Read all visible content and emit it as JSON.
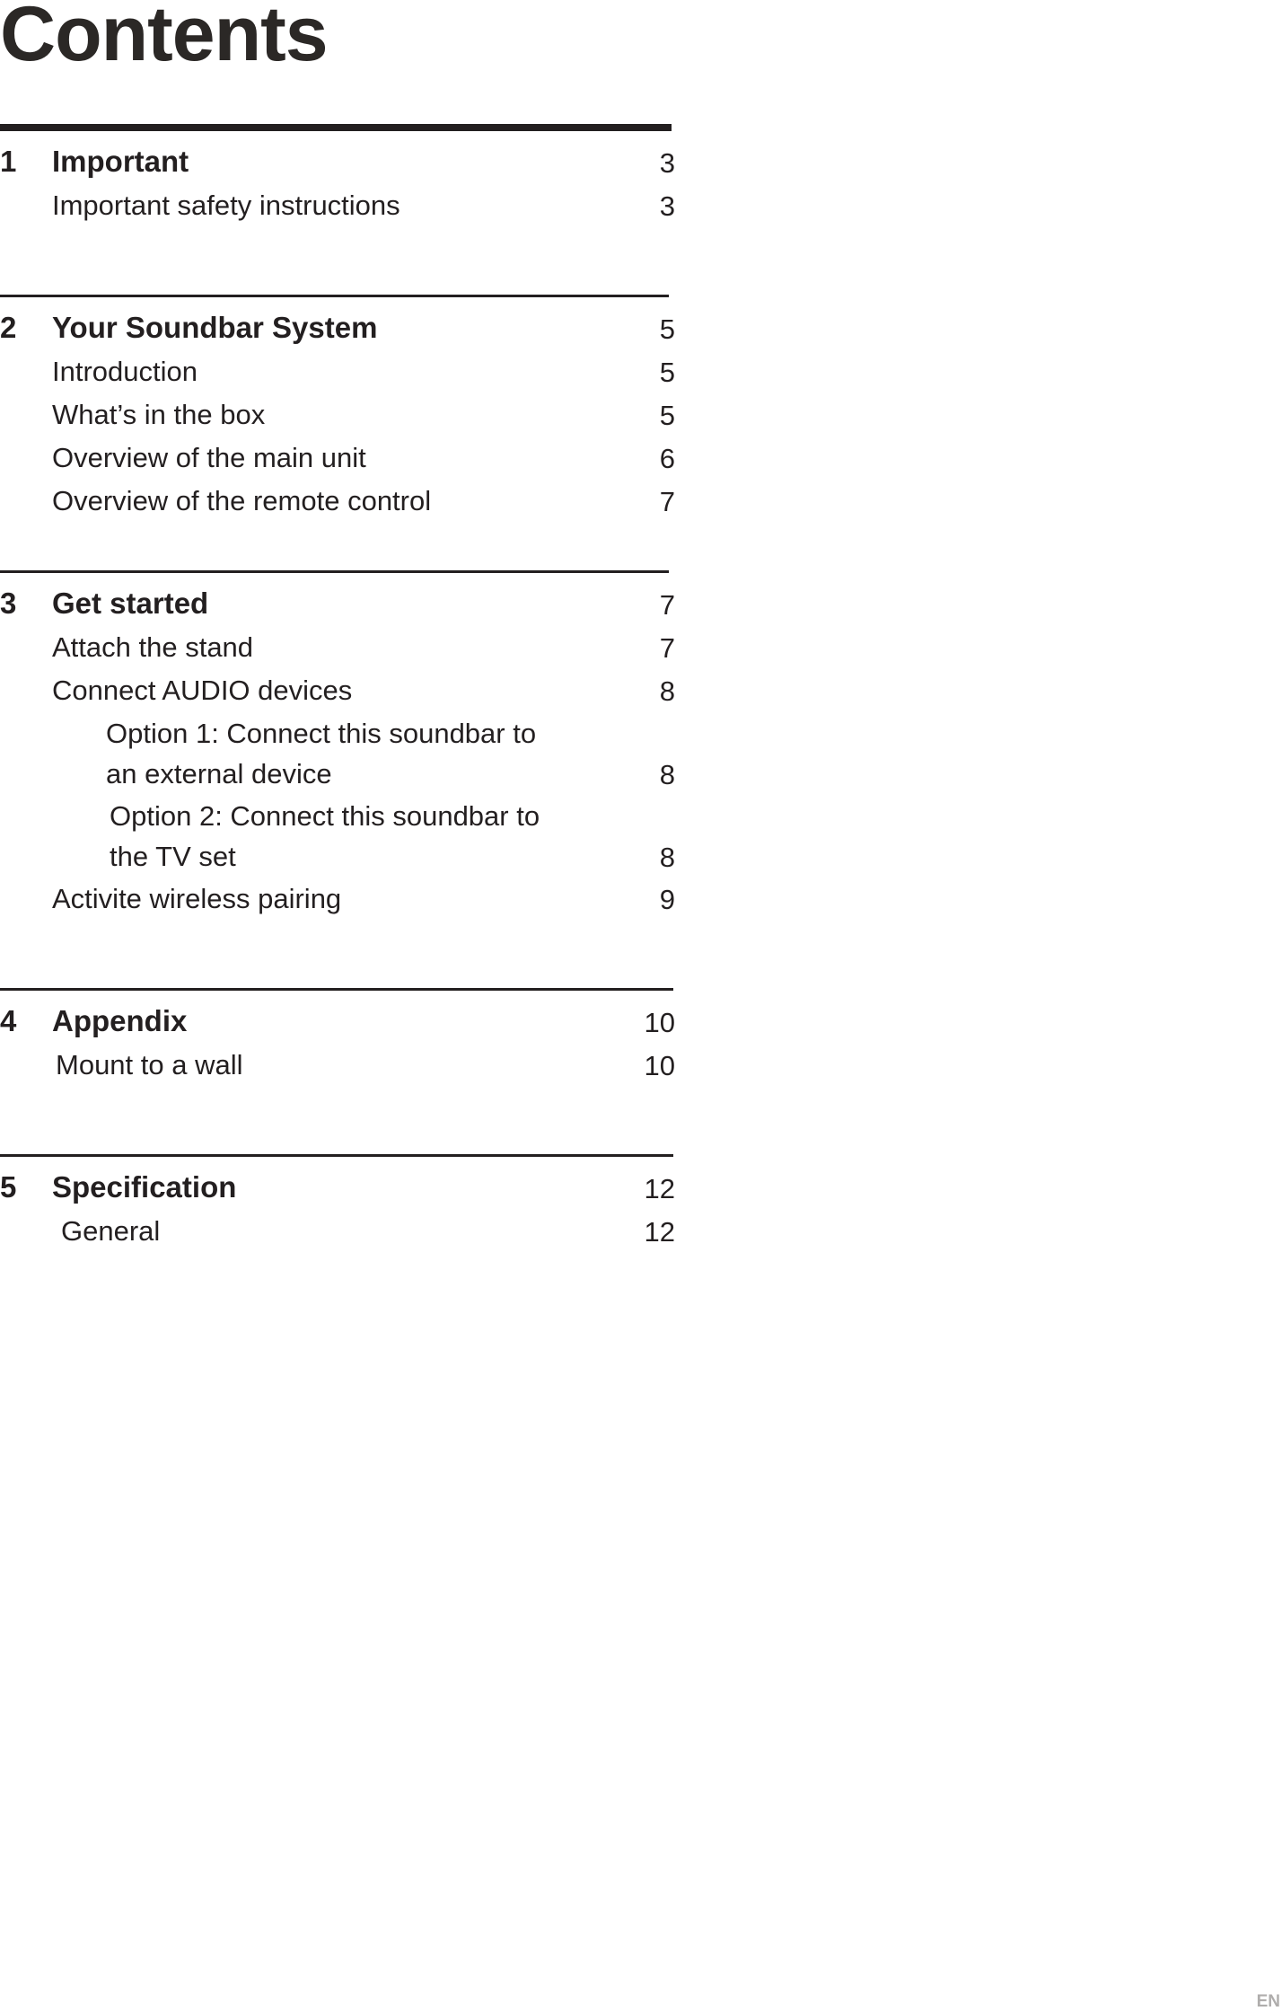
{
  "document": {
    "title": "Contents",
    "edge_marker": "EN"
  },
  "sections": [
    {
      "number": "1",
      "title": "Important",
      "page": "3",
      "rule": "thick",
      "entries": [
        {
          "label": "Important safety instructions",
          "page": "3",
          "level": 1
        }
      ]
    },
    {
      "number": "2",
      "title": "Your Soundbar System",
      "page": "5",
      "rule": "thin",
      "entries": [
        {
          "label": "Introduction",
          "page": "5",
          "level": 1
        },
        {
          "label": "What’s in the box",
          "page": "5",
          "level": 1
        },
        {
          "label": "Overview of the main unit",
          "page": "6",
          "level": 1
        },
        {
          "label": "Overview of the remote control",
          "page": "7",
          "level": 1
        }
      ]
    },
    {
      "number": "3",
      "title": "Get started",
      "page": "7",
      "rule": "thin",
      "entries": [
        {
          "label": "Attach the stand",
          "page": "7",
          "level": 1
        },
        {
          "label": "Connect AUDIO devices",
          "page": "8",
          "level": 1
        },
        {
          "label": "Option 1: Connect this soundbar to an external device",
          "page": "8",
          "level": 2
        },
        {
          "label": "Option 2: Connect this soundbar to the TV set",
          "page": "8",
          "level": 2
        },
        {
          "label": "Activite wireless pairing",
          "page": "9",
          "level": 1
        }
      ]
    },
    {
      "number": "4",
      "title": "Appendix",
      "page": "10",
      "rule": "thin",
      "entries": [
        {
          "label": "Mount to a wall",
          "page": "10",
          "level": 1
        }
      ]
    },
    {
      "number": "5",
      "title": "Specification",
      "page": "12",
      "rule": "thin",
      "entries": [
        {
          "label": "General",
          "page": "12",
          "level": 1
        }
      ]
    }
  ],
  "colors": {
    "text": "#231f20",
    "title": "#2b2826",
    "rule": "#231f20",
    "background": "#ffffff"
  }
}
